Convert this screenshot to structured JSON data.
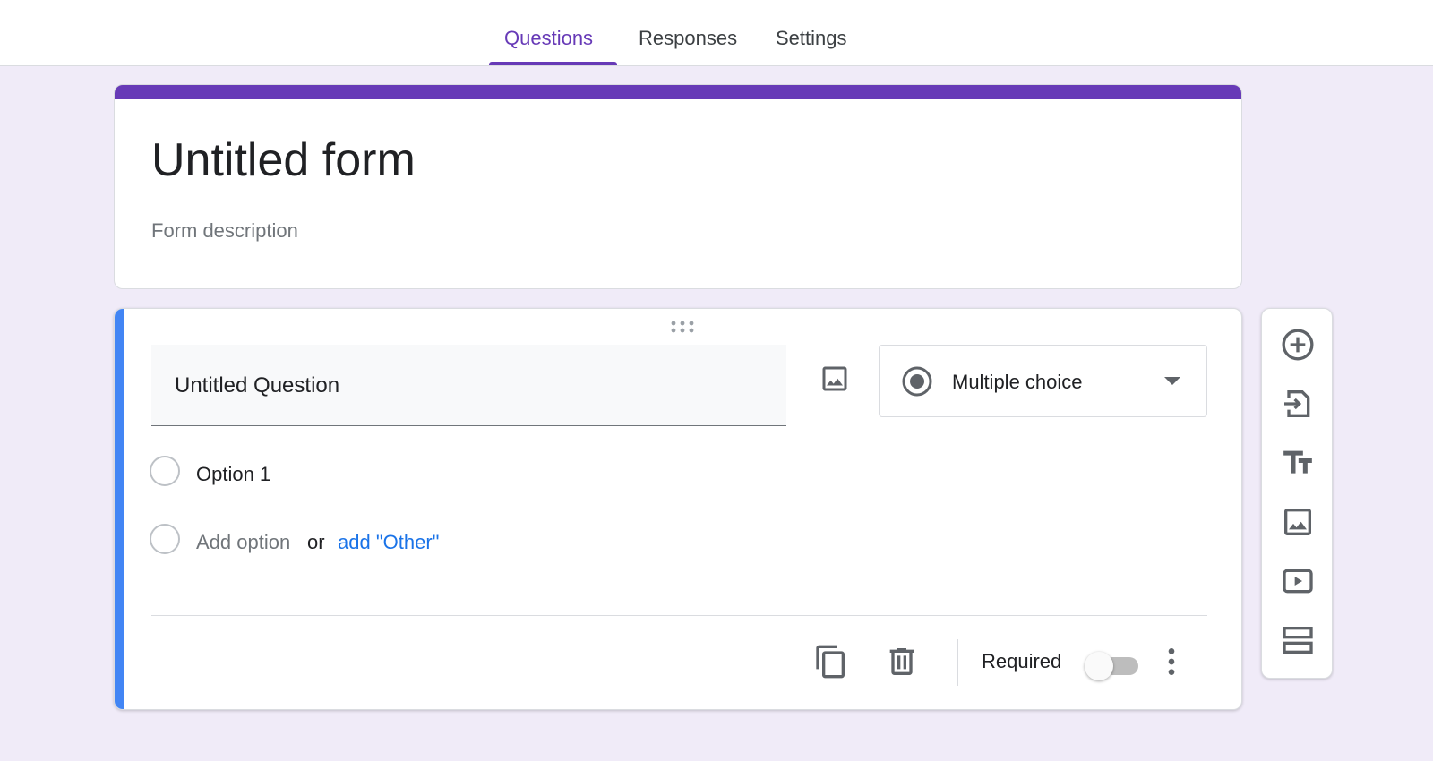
{
  "tabs": [
    {
      "label": "Questions",
      "active": true
    },
    {
      "label": "Responses",
      "active": false
    },
    {
      "label": "Settings",
      "active": false
    }
  ],
  "form": {
    "title": "Untitled form",
    "description_placeholder": "Form description",
    "accent_color": "#673ab7",
    "background_color": "#f0ebf8"
  },
  "question": {
    "title": "Untitled Question",
    "type": {
      "label": "Multiple choice",
      "icon": "radio-button-icon"
    },
    "options": [
      {
        "label": "Option 1"
      }
    ],
    "add_option_label": "Add option",
    "or_label": "or",
    "add_other_label": "add \"Other\"",
    "required_label": "Required",
    "required": false,
    "active_border_color": "#4285f4"
  },
  "footer_actions": [
    {
      "name": "duplicate",
      "icon": "copy-icon"
    },
    {
      "name": "delete",
      "icon": "trash-icon"
    },
    {
      "name": "more",
      "icon": "more-vert-icon"
    }
  ],
  "side_toolbar": [
    {
      "name": "add-question",
      "icon": "add-circle-icon"
    },
    {
      "name": "import-questions",
      "icon": "import-icon"
    },
    {
      "name": "add-title-description",
      "icon": "title-text-icon"
    },
    {
      "name": "add-image",
      "icon": "image-icon"
    },
    {
      "name": "add-video",
      "icon": "video-icon"
    },
    {
      "name": "add-section",
      "icon": "section-icon"
    }
  ]
}
